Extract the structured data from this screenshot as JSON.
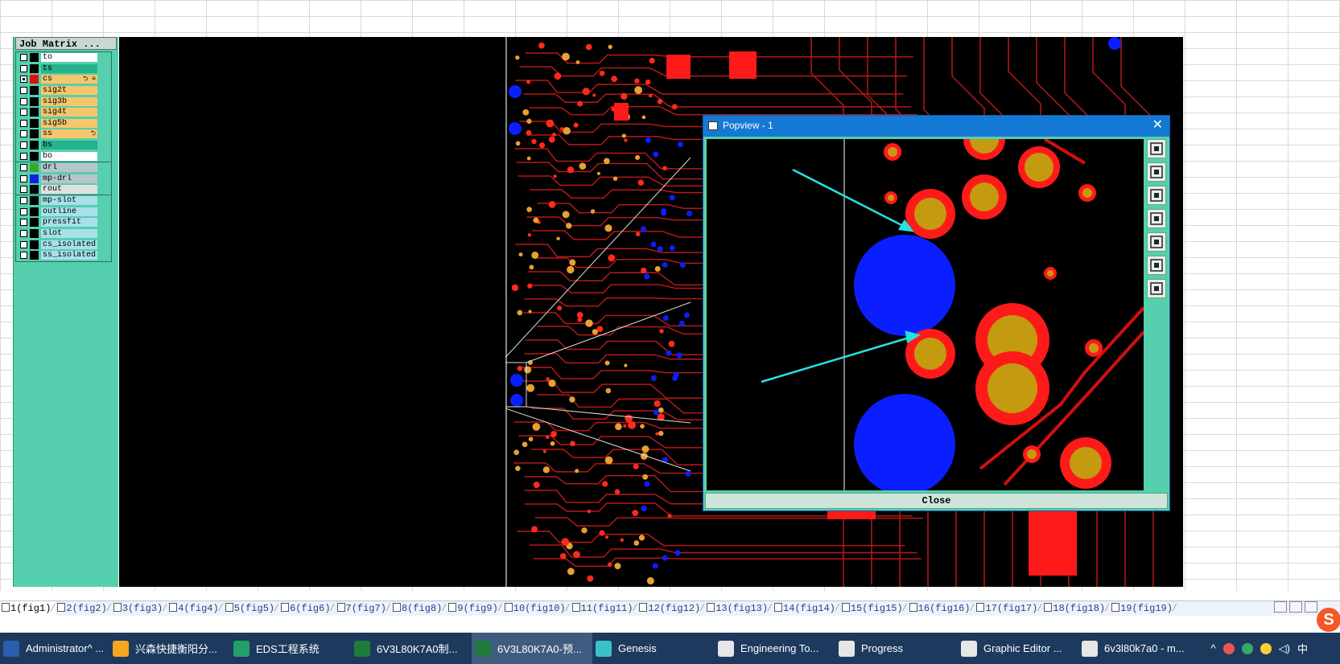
{
  "job_matrix": {
    "title": "Job Matrix ...",
    "groups": [
      [
        {
          "name": "to",
          "swatch": "#000000",
          "bg": "#ffffff",
          "checked": false
        },
        {
          "name": "ts",
          "swatch": "#000000",
          "bg": "#24b38a",
          "checked": false
        },
        {
          "name": "cs",
          "swatch": "#e01010",
          "bg": "#f7c56a",
          "checked": true,
          "tag": "⮌ ≡"
        },
        {
          "name": "sig2t",
          "swatch": "#000000",
          "bg": "#f7c56a",
          "checked": false
        },
        {
          "name": "sig3b",
          "swatch": "#000000",
          "bg": "#f7c56a",
          "checked": false
        },
        {
          "name": "sig4t",
          "swatch": "#000000",
          "bg": "#f7c56a",
          "checked": false
        },
        {
          "name": "sig5b",
          "swatch": "#000000",
          "bg": "#f7c56a",
          "checked": false
        },
        {
          "name": "ss",
          "swatch": "#000000",
          "bg": "#f7c56a",
          "checked": false,
          "tag": "⮌"
        },
        {
          "name": "bs",
          "swatch": "#000000",
          "bg": "#24b38a",
          "checked": false
        },
        {
          "name": "bo",
          "swatch": "#000000",
          "bg": "#ffffff",
          "checked": false
        }
      ],
      [
        {
          "name": "drl",
          "swatch": "#3ea52a",
          "bg": "#b8c4cc",
          "checked": false
        },
        {
          "name": "mp-drl",
          "swatch": "#1020e0",
          "bg": "#b8c4cc",
          "checked": false
        },
        {
          "name": "rout",
          "swatch": "#000000",
          "bg": "#e0e0e0",
          "checked": false
        }
      ],
      [
        {
          "name": "mp-slot",
          "swatch": "#000000",
          "bg": "#a8e0ea",
          "checked": false
        },
        {
          "name": "outline",
          "swatch": "#000000",
          "bg": "#a8e0ea",
          "checked": false
        },
        {
          "name": "pressfit",
          "swatch": "#000000",
          "bg": "#a8e0ea",
          "checked": false
        },
        {
          "name": "slot",
          "swatch": "#000000",
          "bg": "#a8e0ea",
          "checked": false
        },
        {
          "name": "cs_isolated",
          "swatch": "#000000",
          "bg": "#a8e0ea",
          "checked": false
        },
        {
          "name": "ss_isolated",
          "swatch": "#000000",
          "bg": "#a8e0ea",
          "checked": false
        }
      ]
    ]
  },
  "popview": {
    "title": "Popview - 1",
    "close_x": "✕",
    "close_button": "Close",
    "tools": [
      "zoom-fit-icon",
      "zoom-in-icon",
      "zoom-out-icon",
      "pan-left-icon",
      "pan-right-icon",
      "fit-all-icon",
      "zoom-area-icon"
    ]
  },
  "sheet_tabs": [
    "1(fig1)",
    "2(fig2)",
    "3(fig3)",
    "4(fig4)",
    "5(fig5)",
    "6(fig6)",
    "7(fig7)",
    "8(fig8)",
    "9(fig9)",
    "10(fig10)",
    "11(fig11)",
    "12(fig12)",
    "13(fig13)",
    "14(fig14)",
    "15(fig15)",
    "16(fig16)",
    "17(fig17)",
    "18(fig18)",
    "19(fig19)"
  ],
  "taskbar": {
    "items": [
      {
        "label": "Administrator^ ...",
        "color": "#2a5db0",
        "width": 136
      },
      {
        "label": "兴森快捷衡阳分...",
        "color": "#f5a623",
        "width": 150
      },
      {
        "label": "EDS工程系统",
        "color": "#22a06b",
        "width": 150
      },
      {
        "label": "6V3L80K7A0制...",
        "color": "#1f7a3e",
        "width": 150
      },
      {
        "label": "6V3L80K7A0-预...",
        "color": "#1f7a3e",
        "width": 150,
        "active": true
      },
      {
        "label": "Genesis",
        "color": "#3cc0c8",
        "width": 152
      },
      {
        "label": "Engineering To...",
        "color": "#e6e6e6",
        "width": 150
      },
      {
        "label": "Progress",
        "color": "#e6e6e6",
        "width": 152
      },
      {
        "label": "Graphic Editor ...",
        "color": "#e6e6e6",
        "width": 150
      },
      {
        "label": "6v3l80k7a0 - m...",
        "color": "#e6e6e6",
        "width": 150
      }
    ],
    "tray": {
      "ime": "中"
    }
  }
}
